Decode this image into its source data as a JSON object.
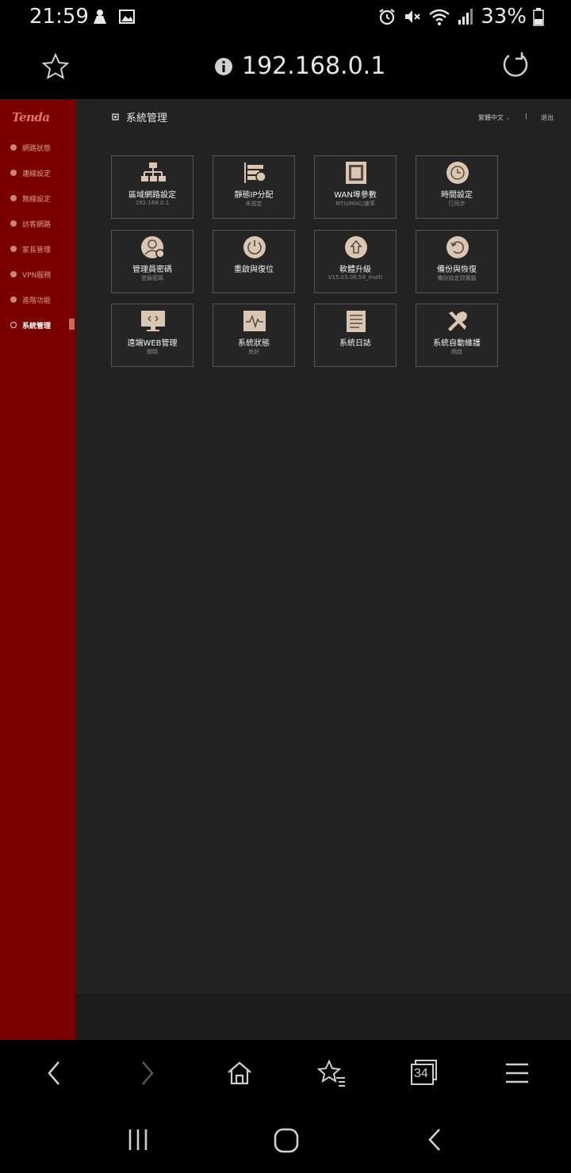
{
  "status_bar": {
    "time": "21:59",
    "battery": "33%",
    "left_icons": [
      "chat-bubble-icon",
      "gallery-icon"
    ],
    "right_icons": [
      "alarm-icon",
      "mute-icon",
      "wifi-icon",
      "signal-icon",
      "battery-icon"
    ]
  },
  "url_bar": {
    "url": "192.168.0.1"
  },
  "router": {
    "brand": "Tenda",
    "page_title": "系統管理",
    "language": "繁體中文",
    "lang_sep": "|",
    "logout": "退出",
    "accent_color": "#d9a07a",
    "sidebar_color": "#7a0000",
    "nav": [
      {
        "label": "網路狀態",
        "icon": "network-status-icon"
      },
      {
        "label": "連線設定",
        "icon": "globe-icon"
      },
      {
        "label": "無線設定",
        "icon": "wifi-icon"
      },
      {
        "label": "訪客網路",
        "icon": "guest-icon"
      },
      {
        "label": "家長管理",
        "icon": "parental-icon"
      },
      {
        "label": "VPN服務",
        "icon": "vpn-icon"
      },
      {
        "label": "進階功能",
        "icon": "advanced-icon"
      },
      {
        "label": "系統管理",
        "icon": "gear-icon",
        "active": true
      }
    ],
    "tiles": [
      {
        "title": "區域網路設定",
        "sub": "192.168.0.1",
        "icon": "lan-topology-icon"
      },
      {
        "title": "靜態IP分配",
        "sub": "未設定",
        "icon": "static-ip-icon"
      },
      {
        "title": "WAN埠參數",
        "sub": "MTU/MAC/速率",
        "icon": "wan-port-icon"
      },
      {
        "title": "時間設定",
        "sub": "已同步",
        "icon": "clock-icon"
      },
      {
        "title": "管理員密碼",
        "sub": "登錄密碼",
        "icon": "admin-password-icon"
      },
      {
        "title": "重啟與復位",
        "sub": "",
        "icon": "power-icon"
      },
      {
        "title": "軟體升級",
        "sub": "V15.03.06.59_multi",
        "icon": "upgrade-icon"
      },
      {
        "title": "備份與恢復",
        "sub": "備份設定到電腦",
        "icon": "backup-restore-icon"
      },
      {
        "title": "遠端WEB管理",
        "sub": "關閉",
        "icon": "remote-web-icon"
      },
      {
        "title": "系統狀態",
        "sub": "良好",
        "icon": "system-status-icon"
      },
      {
        "title": "系統日誌",
        "sub": "",
        "icon": "system-log-icon"
      },
      {
        "title": "系統自動維護",
        "sub": "開啟",
        "icon": "tools-icon"
      }
    ]
  },
  "browser_bar": {
    "tab_count": "34",
    "icons": [
      "back-icon",
      "forward-icon",
      "home-icon",
      "bookmarks-icon",
      "tabs-icon",
      "menu-icon"
    ]
  },
  "system_nav": {
    "icons": [
      "recent-apps-icon",
      "home-button-icon",
      "system-back-icon"
    ]
  }
}
